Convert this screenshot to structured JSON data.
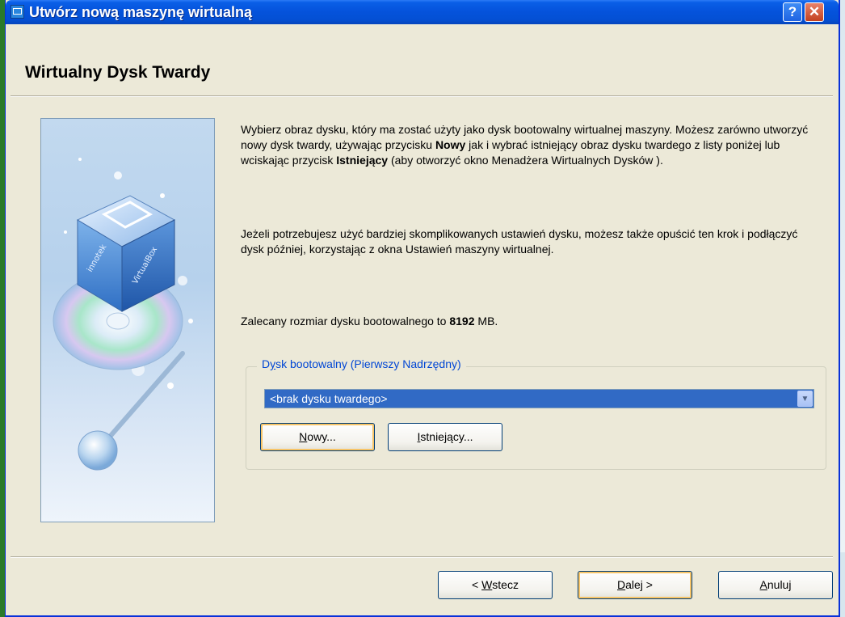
{
  "window": {
    "title": "Utwórz nową maszynę wirtualną",
    "help_label": "?",
    "close_label": "✕"
  },
  "page": {
    "title": "Wirtualny Dysk Twardy"
  },
  "description": {
    "p1_part1": "Wybierz obraz dysku, który ma zostać użyty jako dysk bootowalny wirtualnej maszyny. Możesz zarówno utworzyć nowy dysk twardy, używając przycisku ",
    "p1_bold1": "Nowy",
    "p1_part2": " jak i wybrać istniejący obraz dysku twardego z listy poniżej lub wciskając przycisk ",
    "p1_bold2": "Istniejący",
    "p1_part3": " (aby otworzyć okno Menadżera Wirtualnych Dysków ).",
    "p2": "Jeżeli potrzebujesz użyć bardziej skomplikowanych ustawień dysku, możesz także opuścić ten krok i podłączyć dysk później, korzystając z okna Ustawień maszyny wirtualnej.",
    "p3_prefix": "Zalecany rozmiar dysku bootowalnego to ",
    "p3_value": "8192",
    "p3_suffix": " MB."
  },
  "boot_disk": {
    "legend_pre": "D",
    "legend_hot": "y",
    "legend_post": "sk bootowalny (Pierwszy Nadrzędny)",
    "selected": "<brak dysku twardego>",
    "new_hot": "N",
    "new_rest": "owy...",
    "existing_hot": "I",
    "existing_rest": "stniejący..."
  },
  "footer": {
    "back_prefix": "< ",
    "back_hot": "W",
    "back_rest": "stecz",
    "next_hot": "D",
    "next_rest": "alej >",
    "cancel_hot": "A",
    "cancel_rest": "nuluj"
  },
  "icons": {
    "app": "virtualbox-icon",
    "wizard_art": "virtualbox-cube-disc-illustration"
  },
  "colors": {
    "titlebar": "#0553dc",
    "window_bg": "#ece9d8",
    "selection": "#316ac5",
    "group_legend": "#0046d5"
  }
}
